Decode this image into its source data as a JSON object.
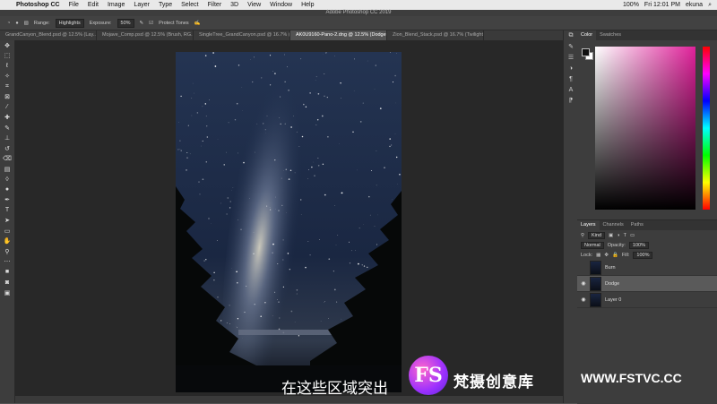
{
  "menubar": {
    "app": "Photoshop CC",
    "items": [
      "File",
      "Edit",
      "Image",
      "Layer",
      "Type",
      "Select",
      "Filter",
      "3D",
      "View",
      "Window",
      "Help"
    ],
    "battery": "100%",
    "clock": "Fri 12:01 PM",
    "user": "ekuna"
  },
  "window_title": "Adobe Photoshop CC 2019",
  "options_bar": {
    "range_label": "Range:",
    "range_value": "Highlights",
    "exposure_label": "Exposure:",
    "exposure_value": "50%",
    "protect_tones": "Protect Tones"
  },
  "tabs": [
    "GrandCanyon_Blend.psd @ 12.5% (Lay...",
    "Mojave_Comp.psd @ 12.5% (Brush, RG...",
    "SingleTree_GrandCanyon.psd @ 16.7% (R...",
    "AK0U9160-Pano-2.dng @ 12.5% (Dodge, RGB/16) *",
    "Zion_Blend_Stack.psd @ 16.7% (Twilight, ..."
  ],
  "color_panel": {
    "tab_color": "Color",
    "tab_swatches": "Swatches"
  },
  "layers_panel": {
    "tabs": [
      "Layers",
      "Channels",
      "Paths"
    ],
    "filter": "Kind",
    "blend_mode": "Normal",
    "opacity_label": "Opacity:",
    "opacity": "100%",
    "lock_label": "Lock:",
    "fill_label": "Fill:",
    "fill": "100%",
    "layers": [
      {
        "name": "Burn",
        "visible": false,
        "selected": false
      },
      {
        "name": "Dodge",
        "visible": true,
        "selected": true
      },
      {
        "name": "Layer 0",
        "visible": true,
        "selected": false
      }
    ]
  },
  "watermark": {
    "logo_text": "FS",
    "brand_text": "梵摄创意库",
    "url": "WWW.FSTVC.CC"
  },
  "subtitle": "在这些区域突出",
  "colors": {
    "accent": "#e0219a",
    "panel": "#3d3d3d",
    "canvas": "#282828"
  }
}
